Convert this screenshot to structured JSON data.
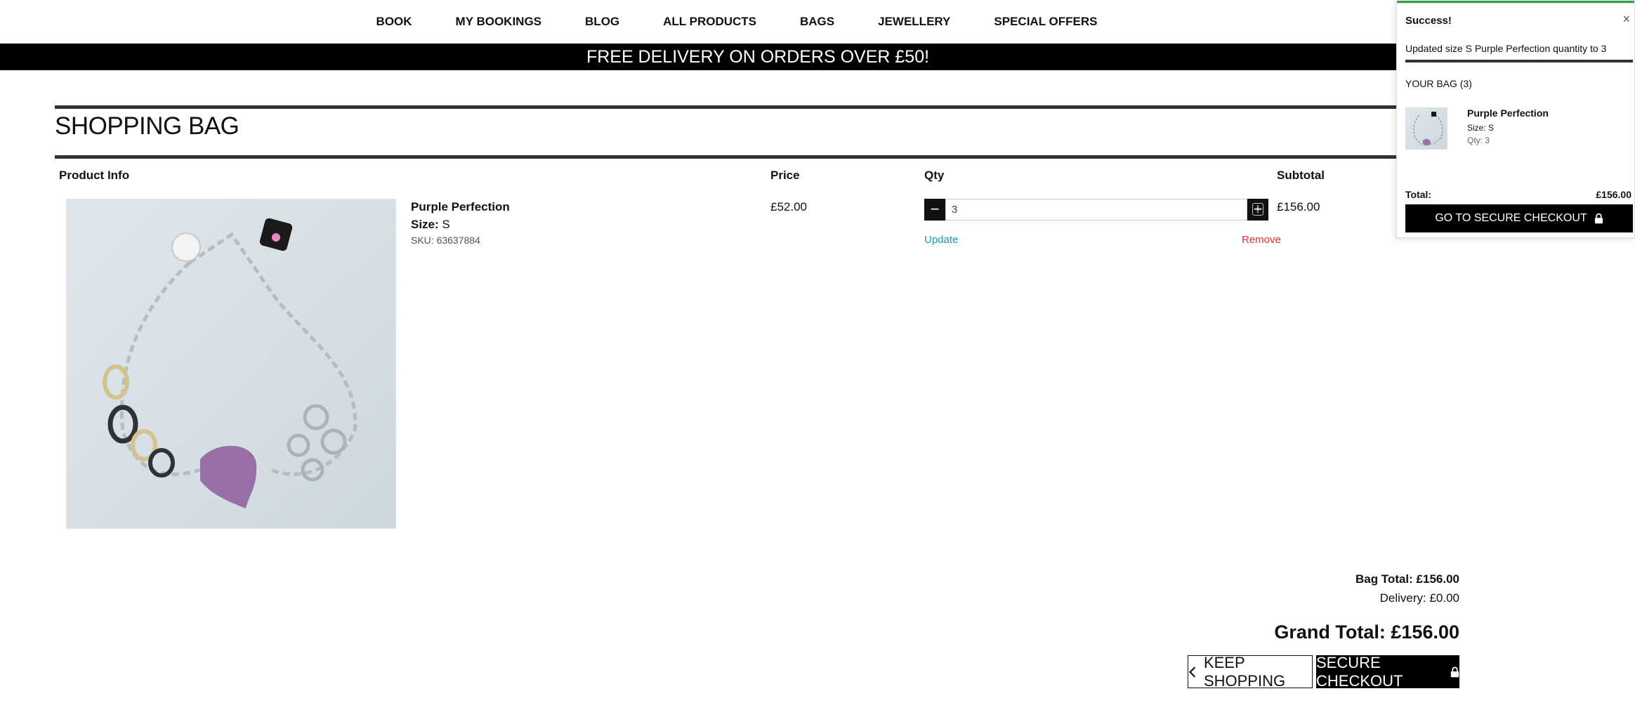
{
  "nav": {
    "items": [
      "BOOK",
      "MY BOOKINGS",
      "BLOG",
      "ALL PRODUCTS",
      "BAGS",
      "JEWELLERY",
      "SPECIAL OFFERS"
    ]
  },
  "promo": "FREE DELIVERY ON ORDERS OVER £50!",
  "page": {
    "title": "SHOPPING BAG"
  },
  "table": {
    "headers": {
      "product": "Product Info",
      "price": "Price",
      "qty": "Qty",
      "subtotal": "Subtotal"
    }
  },
  "item": {
    "name": "Purple Perfection",
    "size_label": "Size:",
    "size": "S",
    "sku": "SKU: 63637884",
    "price": "£52.00",
    "qty": "3",
    "subtotal": "£156.00",
    "update": "Update",
    "remove": "Remove",
    "minus": "−",
    "plus": "+"
  },
  "totals": {
    "bag_total": "Bag Total: £156.00",
    "delivery": "Delivery: £0.00",
    "grand_total": "Grand Total: £156.00"
  },
  "actions": {
    "keep_shopping": "KEEP SHOPPING",
    "secure_checkout": "SECURE CHECKOUT"
  },
  "popup": {
    "title": "Success!",
    "close": "×",
    "message": "Updated size S Purple Perfection quantity to 3",
    "bag_count": "YOUR BAG (3)",
    "item_name": "Purple Perfection",
    "item_size": "Size: S",
    "item_qty": "Qty: 3",
    "total_label": "Total:",
    "total_value": "£156.00",
    "checkout": "GO TO SECURE CHECKOUT"
  },
  "colors": {
    "accent_link": "#17a0b3",
    "remove": "#dd3333",
    "success": "#2e9e3e"
  }
}
